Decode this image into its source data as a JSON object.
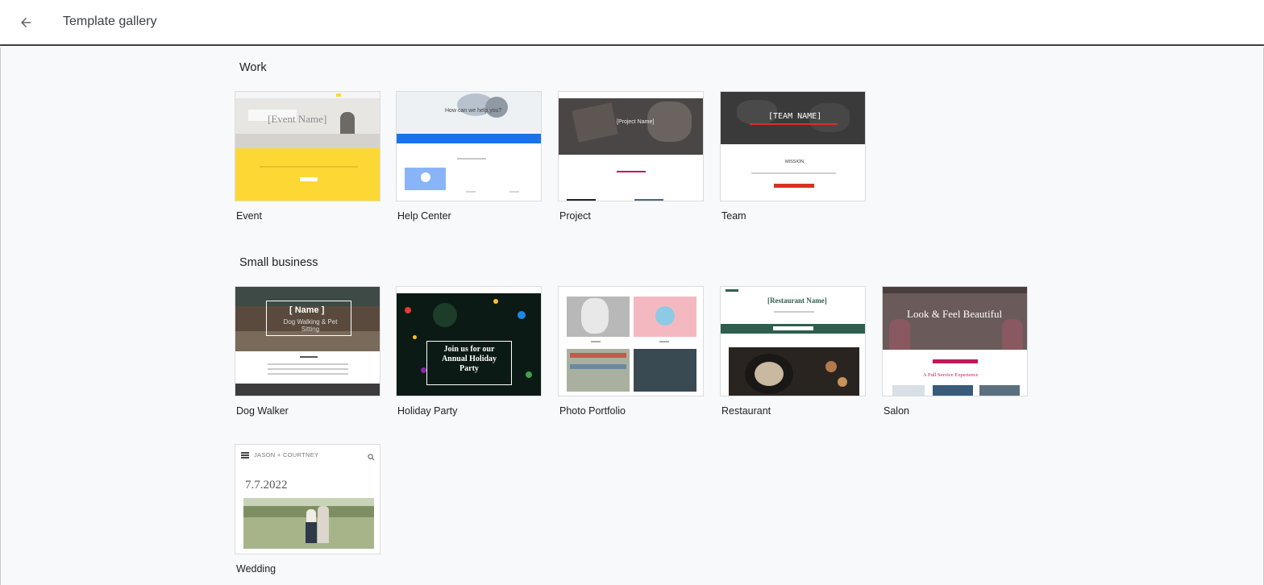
{
  "header": {
    "title": "Template gallery",
    "back_icon": "arrow-back-icon"
  },
  "sections": [
    {
      "title": "Work",
      "templates": [
        {
          "name": "Event",
          "preview": {
            "heading": "[Event Name]"
          }
        },
        {
          "name": "Help Center",
          "preview": {
            "heading": "How can we help you?"
          }
        },
        {
          "name": "Project",
          "preview": {
            "heading": "[Project Name]"
          }
        },
        {
          "name": "Team",
          "preview": {
            "heading": "[TEAM NAME]",
            "subheading": "MISSION"
          }
        }
      ]
    },
    {
      "title": "Small business",
      "templates": [
        {
          "name": "Dog Walker",
          "preview": {
            "heading": "[ Name ]",
            "subheading": "Dog Walking & Pet Sitting"
          }
        },
        {
          "name": "Holiday Party",
          "preview": {
            "heading": "Join us for our Annual Holiday Party"
          }
        },
        {
          "name": "Photo Portfolio",
          "preview": {}
        },
        {
          "name": "Restaurant",
          "preview": {
            "heading": "[Restaurant Name]"
          }
        },
        {
          "name": "Salon",
          "preview": {
            "heading": "Look & Feel Beautiful",
            "subheading": "A Full Service Experience"
          }
        }
      ]
    },
    {
      "title": "",
      "templates": [
        {
          "name": "Wedding",
          "preview": {
            "heading": "JASON + COURTNEY",
            "date": "7.7.2022"
          }
        }
      ]
    }
  ],
  "colors": {
    "event_yellow": "#fdd835",
    "help_blue": "#1a73e8",
    "team_red": "#d93025",
    "salon_pink": "#c2185b",
    "restaurant_green": "#2e5e4e"
  }
}
